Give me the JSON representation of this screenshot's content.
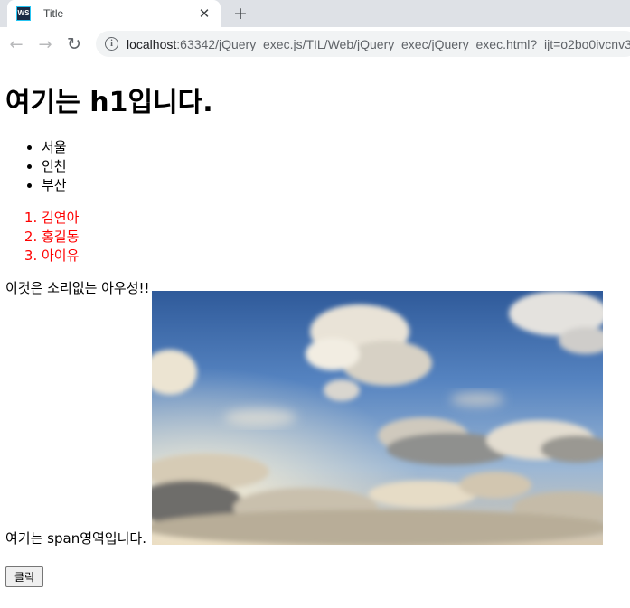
{
  "browser": {
    "tab_title": "Title",
    "favicon_text": "WS",
    "tab_close_glyph": "✕",
    "new_tab_glyph": "+",
    "url_host": "localhost",
    "url_rest": ":63342/jQuery_exec.js/TIL/Web/jQuery_exec/jQuery_exec.html?_ijt=o2bo0ivcnv3",
    "icons": [
      "back-arrow-icon",
      "forward-arrow-icon",
      "reload-icon",
      "info-icon",
      "close-icon",
      "plus-icon"
    ]
  },
  "page": {
    "heading": "여기는 h1입니다.",
    "cities": [
      "서울",
      "인천",
      "부산"
    ],
    "people": [
      "김연아",
      "홍길동",
      "아이유"
    ],
    "people_color": "#ff0000",
    "paragraph": "이것은 소리없는 아우성!!",
    "span_text": "여기는 span영역입니다.",
    "button_label": "클릭"
  }
}
